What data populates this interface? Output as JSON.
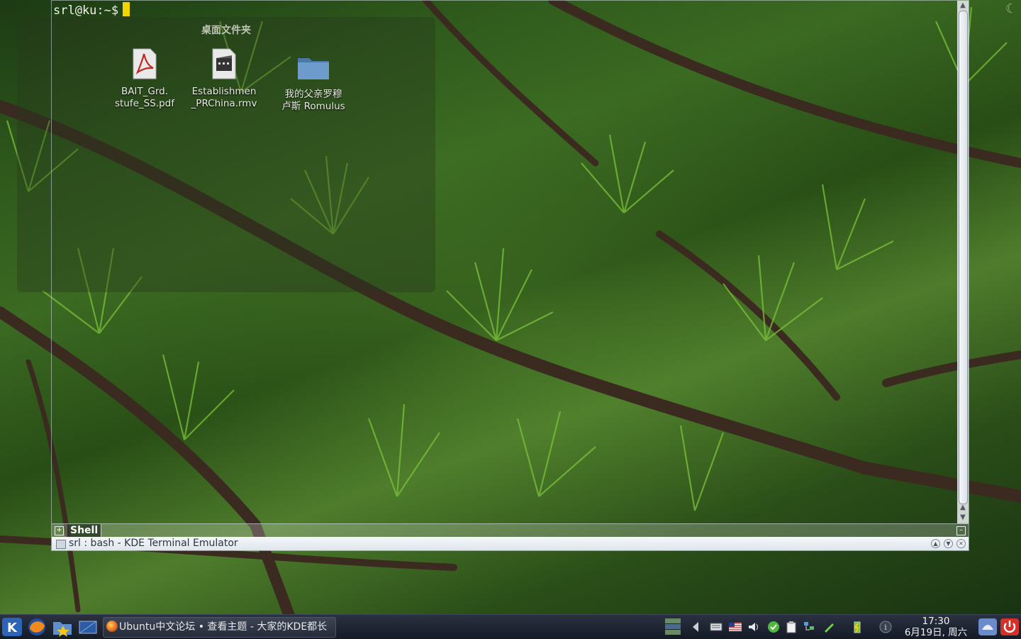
{
  "terminal": {
    "prompt": "srl@ku:~$",
    "tab_label": "Shell",
    "window_title": "srl : bash - KDE Terminal Emulator"
  },
  "folderview": {
    "title": "桌面文件夹",
    "items": [
      {
        "line1": "BAIT_Grd.",
        "line2": "stufe_SS.pdf",
        "icon": "pdf-file-icon"
      },
      {
        "line1": "Establishmen",
        "line2": "_PRChina.rmv",
        "icon": "video-file-icon"
      },
      {
        "line1": "我的父亲罗穆",
        "line2": "卢斯 Romulus",
        "icon": "folder-icon"
      }
    ]
  },
  "taskbar": {
    "task_label": "Ubuntu中文论坛 • 查看主题 - 大家的KDE都长",
    "clock_time": "17:30",
    "clock_date": "6月19日, 周六"
  },
  "colors": {
    "cursor": "#f2d400",
    "titlebar": "#e8edf2",
    "panel": "#1c2230"
  }
}
